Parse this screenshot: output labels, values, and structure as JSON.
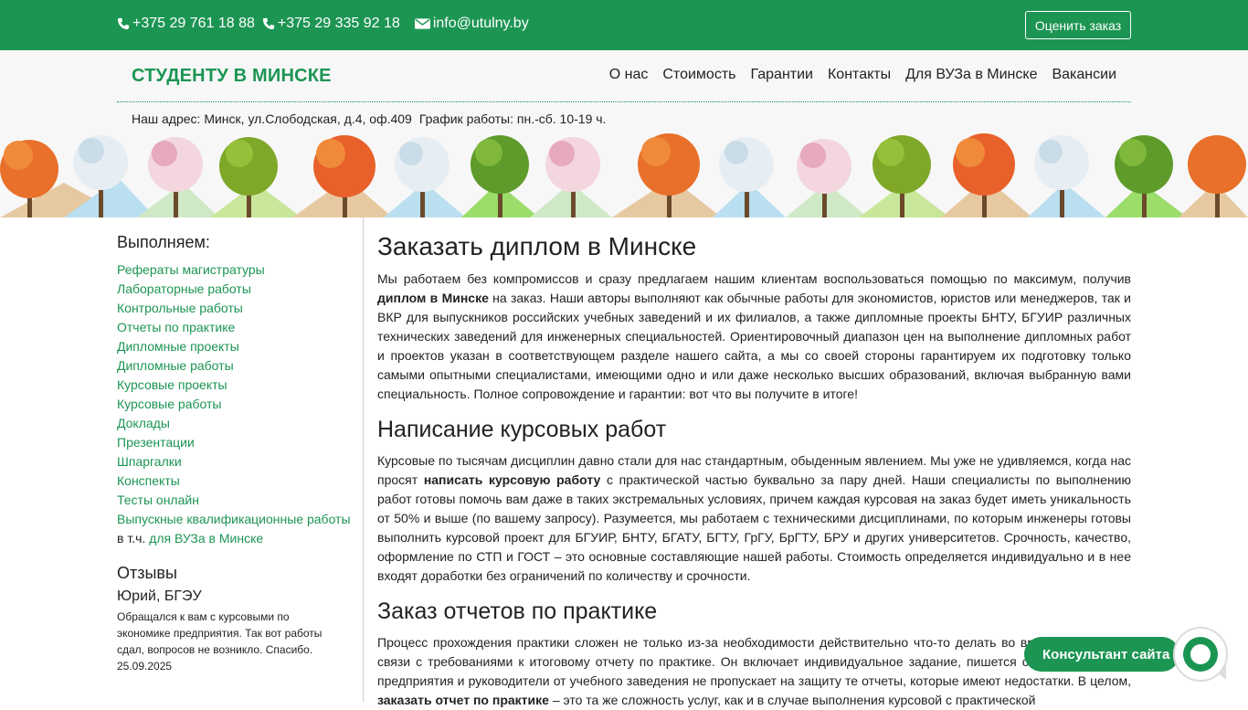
{
  "topbar": {
    "phone1": "+375 29 761 18 88",
    "phone2": "+375 29 335 92 18",
    "email": "info@utulny.by",
    "rate_button": "Оценить заказ"
  },
  "header": {
    "brand": "СТУДЕНТУ В МИНСКЕ",
    "nav": [
      "О нас",
      "Стоимость",
      "Гарантии",
      "Контакты",
      "Для ВУЗа в Минске",
      "Вакансии"
    ],
    "address": "Наш адрес: Минск, ул.Слободская, д.4, оф.409",
    "hours": "График работы: пн.-сб. 10-19 ч."
  },
  "sidebar": {
    "title": "Выполняем:",
    "items": [
      "Рефераты магистратуры",
      "Лабораторные работы",
      "Контрольные работы",
      "Отчеты по практике",
      "Дипломные проекты",
      "Дипломные работы",
      "Курсовые проекты",
      "Курсовые работы",
      "Доклады",
      "Презентации",
      "Шпаргалки",
      "Конспекты",
      "Тесты онлайн",
      "Выпускные квалификационные работы"
    ],
    "incl_prefix": "в т.ч.",
    "incl_link": "для ВУЗа в Минске",
    "reviews_title": "Отзывы",
    "review": {
      "author": "Юрий, БГЭУ",
      "text": "Обращался к вам с курсовыми по экономике предприятия. Так вот работы сдал, вопросов не возникло. Спасибо.",
      "date": "25.09.2025"
    }
  },
  "main": {
    "h1": "Заказать диплом в Минске",
    "p1_a": "Мы работаем без компромиссов и сразу предлагаем нашим клиентам воспользоваться помощью по максимум, получив ",
    "p1_b": "диплом в Минске",
    "p1_c": " на заказ. Наши авторы выполняют как обычные работы для экономистов, юристов или менеджеров, так и ВКР для выпускников российских учебных заведений и их филиалов, а также дипломные проекты БНТУ, БГУИР различных технических заведений для инженерных специальностей. Ориентировочный диапазон цен на выполнение дипломных работ и проектов указан в соответствующем разделе нашего сайта, а мы со своей стороны гарантируем их подготовку только самыми опытными специалистами, имеющими одно и или даже несколько высших образований, включая выбранную вами специальность. Полное сопровождение и гарантии: вот что вы получите в итоге!",
    "h2a": "Написание курсовых работ",
    "p2_a": "Курсовые по тысячам дисциплин давно стали для нас стандартным, обыденным явлением. Мы уже не удивляемся, когда нас просят ",
    "p2_b": "написать курсовую работу",
    "p2_c": " с практической частью буквально за пару дней. Наши специалисты по выполнению работ готовы помочь вам даже в таких экстремальных условиях, причем каждая курсовая на заказ будет иметь уникальность от 50% и выше (по вашему запросу). Разумеется, мы работаем с техническими дисциплинами, по которым инженеры готовы выполнить курсовой проект для БГУИР, БНТУ, БГАТУ, БГТУ, ГрГУ, БрГТУ, БРУ и других университетов. Срочность, качество, оформление по СТП и ГОСТ – это основные составляющие нашей работы. Стоимость определяется индивидуально и в нее входят доработки без ограничений по количеству и срочности.",
    "h2b": "Заказ отчетов по практике",
    "p3_a": "Процесс прохождения практики сложен не только из-за необходимости действительно что-то делать во время нее, но и в связи с требованиями к итоговому отчету по практике. Он включает индивидуальное задание, пишется строго по нормам предприятия и руководители от учебного заведения не пропускает на защиту те отчеты, которые имеют недостатки. В целом, ",
    "p3_b": "заказать отчет по практике",
    "p3_c": " – это та же сложность услуг, как и в случае выполнения курсовой с практической"
  },
  "widget": {
    "label": "Консультант сайта"
  },
  "colors": {
    "brand_green": "#1c9553",
    "header_bg": "#f7f7f7"
  }
}
